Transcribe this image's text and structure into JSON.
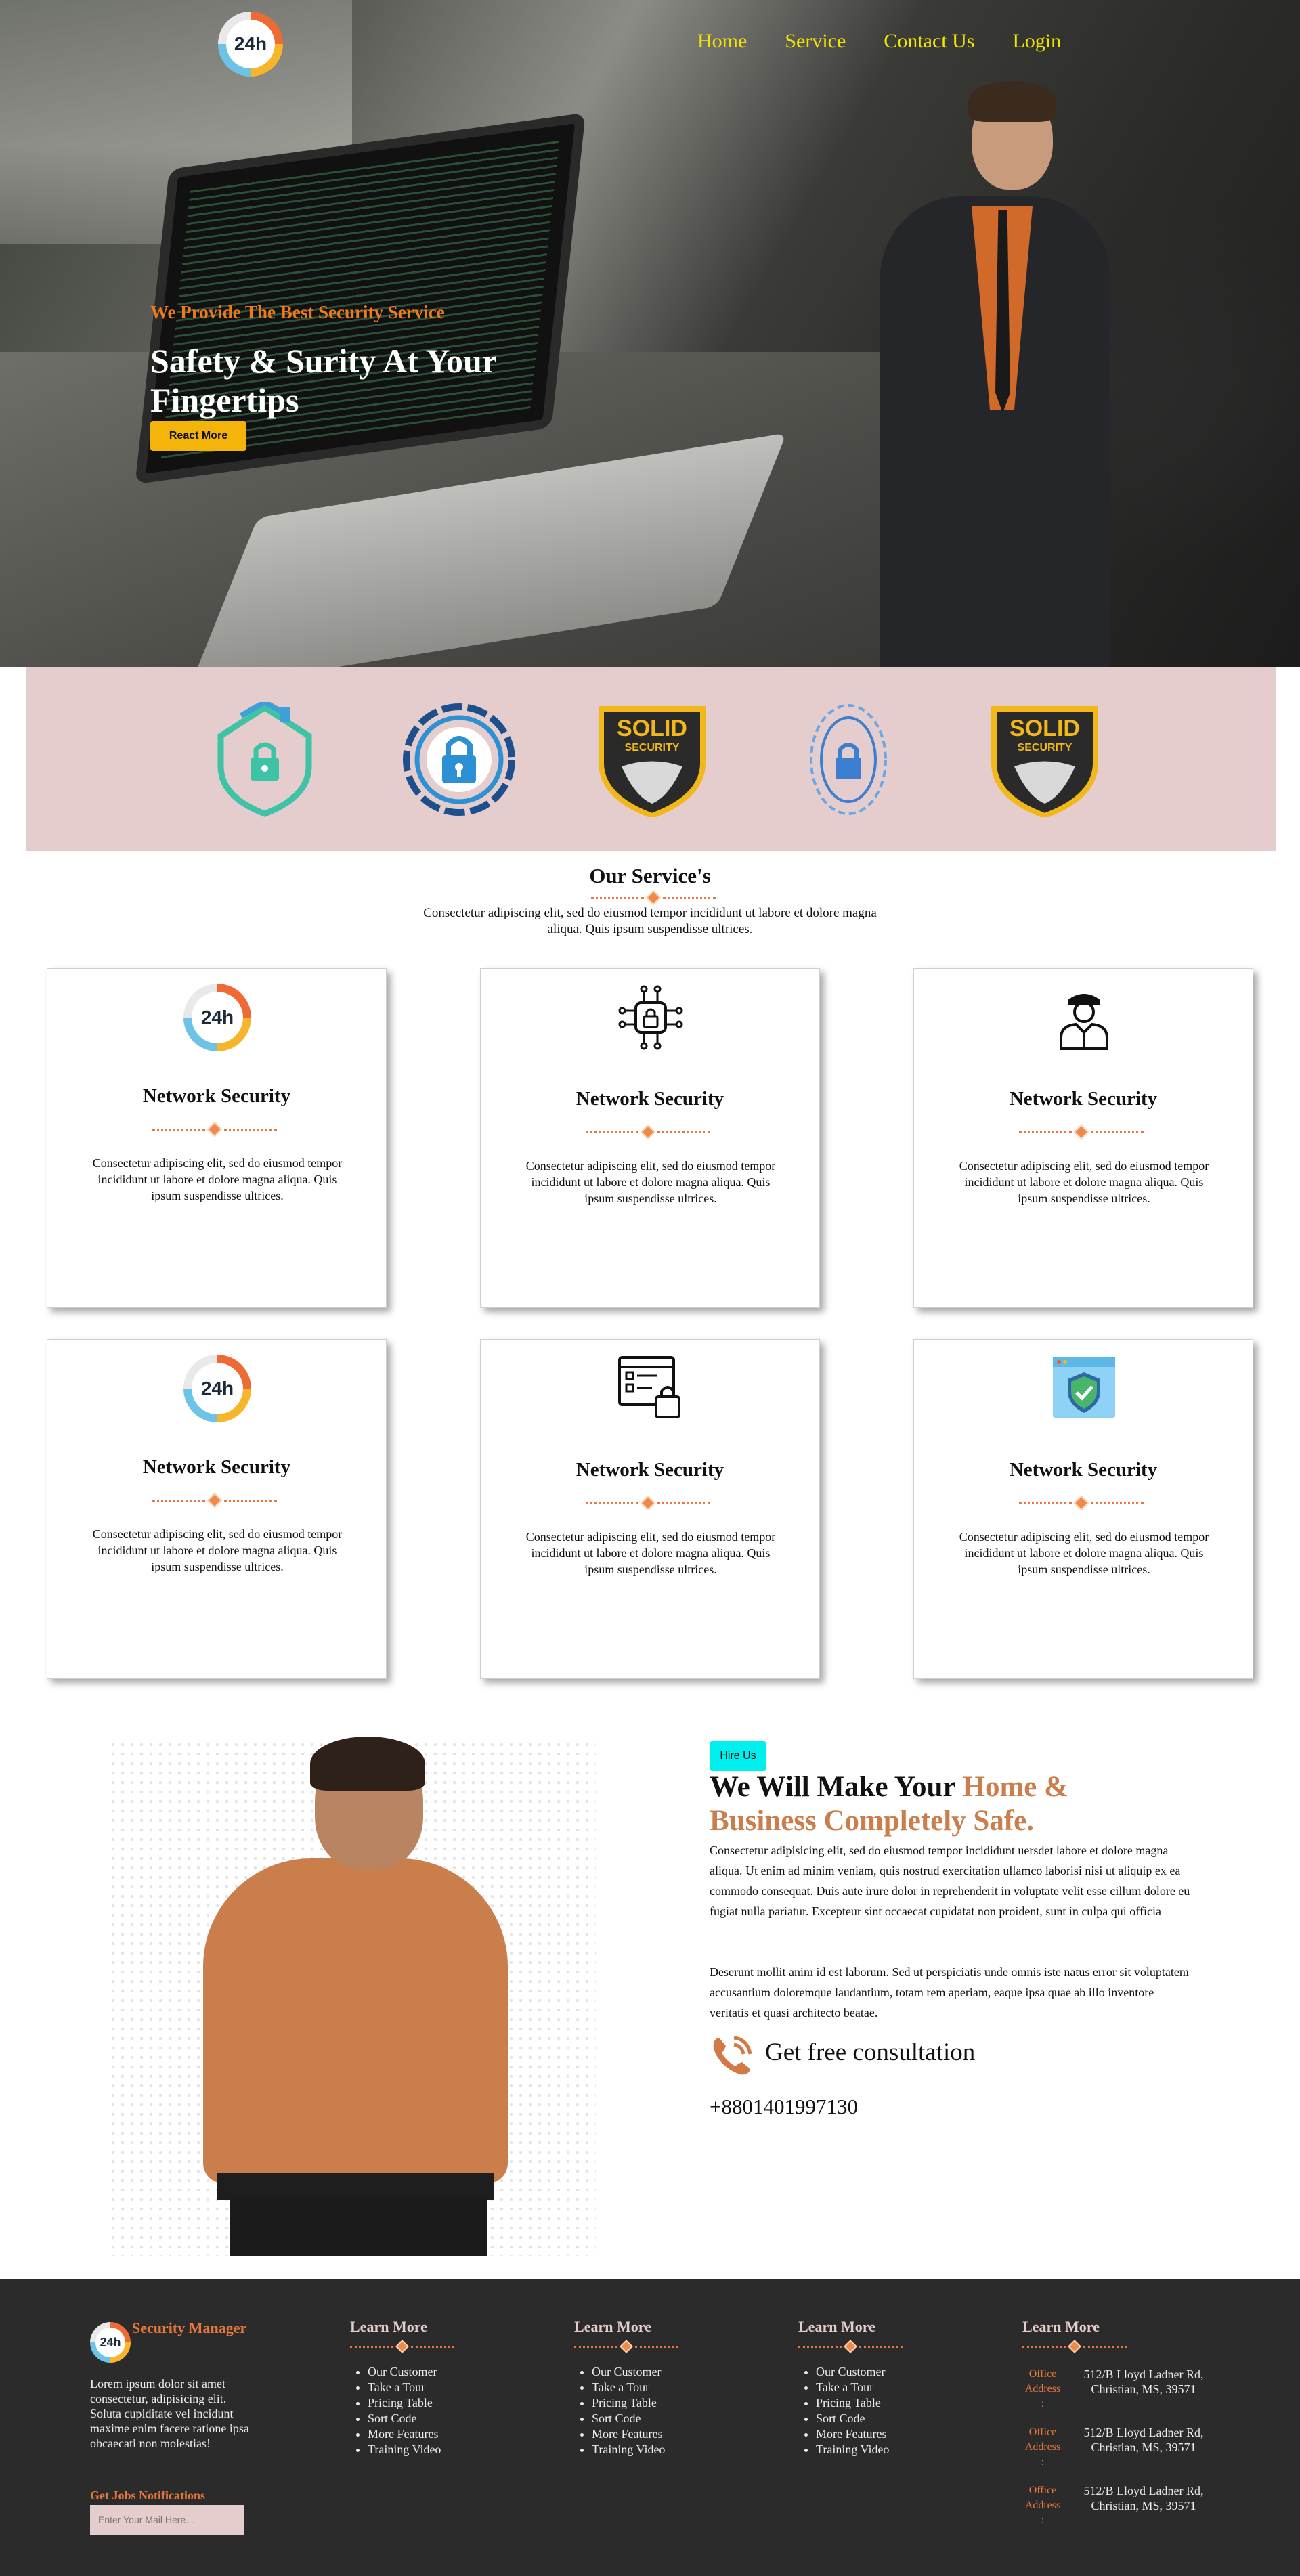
{
  "brand": {
    "logo_text": "24h",
    "name": "Security Manager"
  },
  "nav": {
    "items": [
      "Home",
      "Service",
      "Contact Us",
      "Login"
    ]
  },
  "hero": {
    "subtitle": "We Provide The Best Security Service",
    "title": "Safety & Surity At Your Fingertips",
    "button": "React More"
  },
  "badges": [
    "house-lock",
    "fingerprint-lock",
    "solid-security",
    "fingerprint-circle",
    "solid-security"
  ],
  "badge_text": {
    "solid": "SOLID",
    "security": "SECURITY"
  },
  "services": {
    "title": "Our Service's",
    "description": "Consectetur adipiscing elit, sed do eiusmod tempor incididunt ut labore et dolore magna aliqua. Quis ipsum suspendisse ultrices.",
    "cards": [
      {
        "icon": "24h-icon",
        "title": "Network Security",
        "text": "Consectetur adipiscing elit, sed do eiusmod tempor incididunt ut labore et dolore magna aliqua. Quis ipsum suspendisse ultrices."
      },
      {
        "icon": "circuit-lock-icon",
        "title": "Network Security",
        "text": "Consectetur adipiscing elit, sed do eiusmod tempor incididunt ut labore et dolore magna aliqua. Quis ipsum suspendisse ultrices."
      },
      {
        "icon": "security-guard-icon",
        "title": "Network Security",
        "text": "Consectetur adipiscing elit, sed do eiusmod tempor incididunt ut labore et dolore magna aliqua. Quis ipsum suspendisse ultrices."
      },
      {
        "icon": "24h-icon",
        "title": "Network Security",
        "text": "Consectetur adipiscing elit, sed do eiusmod tempor incididunt ut labore et dolore magna aliqua. Quis ipsum suspendisse ultrices."
      },
      {
        "icon": "checklist-lock-icon",
        "title": "Network Security",
        "text": "Consectetur adipiscing elit, sed do eiusmod tempor incididunt ut labore et dolore magna aliqua. Quis ipsum suspendisse ultrices."
      },
      {
        "icon": "browser-shield-icon",
        "title": "Network Security",
        "text": "Consectetur adipiscing elit, sed do eiusmod tempor incididunt ut labore et dolore magna aliqua. Quis ipsum suspendisse ultrices."
      }
    ]
  },
  "hire": {
    "badge": "Hire Us",
    "title_plain": "We Will Make Your ",
    "title_accent": "Home & Business Completely Safe.",
    "p1": "Consectetur adipisicing elit, sed do eiusmod tempor incididunt uersdet labore et dolore magna aliqua. Ut enim ad minim veniam, quis nostrud exercitation ullamco laborisi nisi ut aliquip ex ea commodo consequat. Duis aute irure dolor in reprehenderit in voluptate velit esse cillum dolore eu fugiat nulla pariatur. Excepteur sint occaecat cupidatat non proident, sunt in culpa qui officia",
    "p2": "Deserunt mollit anim id est laborum. Sed ut perspiciatis unde omnis iste natus error sit voluptatem accusantium doloremque laudantium, totam rem aperiam, eaque ipsa quae ab illo inventore veritatis et quasi architecto beatae.",
    "consult": "Get free consultation",
    "phone": "+8801401997130"
  },
  "footer": {
    "about": "Lorem ipsum dolor sit amet consectetur, adipisicing elit. Soluta cupiditate vel incidunt maxime enim facere ratione ipsa obcaecati non molestias!",
    "jobs_label": "Get Jobs Notifications",
    "email_placeholder": "Enter Your Mail Here...",
    "columns": [
      {
        "title": "Learn More",
        "items": [
          "Our Customer",
          "Take a Tour",
          "Pricing Table",
          "Sort Code",
          "More Features",
          "Training Video"
        ]
      },
      {
        "title": "Learn More",
        "items": [
          "Our Customer",
          "Take a Tour",
          "Pricing Table",
          "Sort Code",
          "More Features",
          "Training Video"
        ]
      },
      {
        "title": "Learn More",
        "items": [
          "Our Customer",
          "Take a Tour",
          "Pricing Table",
          "Sort Code",
          "More Features",
          "Training Video"
        ]
      }
    ],
    "address_column": {
      "title": "Learn More",
      "addresses": [
        {
          "label": "Office Address :",
          "value": "512/B Lloyd Ladner Rd, Christian, MS, 39571"
        },
        {
          "label": "Office Address :",
          "value": "512/B Lloyd Ladner Rd, Christian, MS, 39571"
        },
        {
          "label": "Office Address :",
          "value": "512/B Lloyd Ladner Rd, Christian, MS, 39571"
        }
      ]
    }
  },
  "colors": {
    "accent": "#e8773d",
    "nav": "#f5e600",
    "button": "#f5b40a",
    "strip": "#e6cdcd",
    "hire_badge": "#00f0f0",
    "footer_bg": "#2b2b2b"
  }
}
